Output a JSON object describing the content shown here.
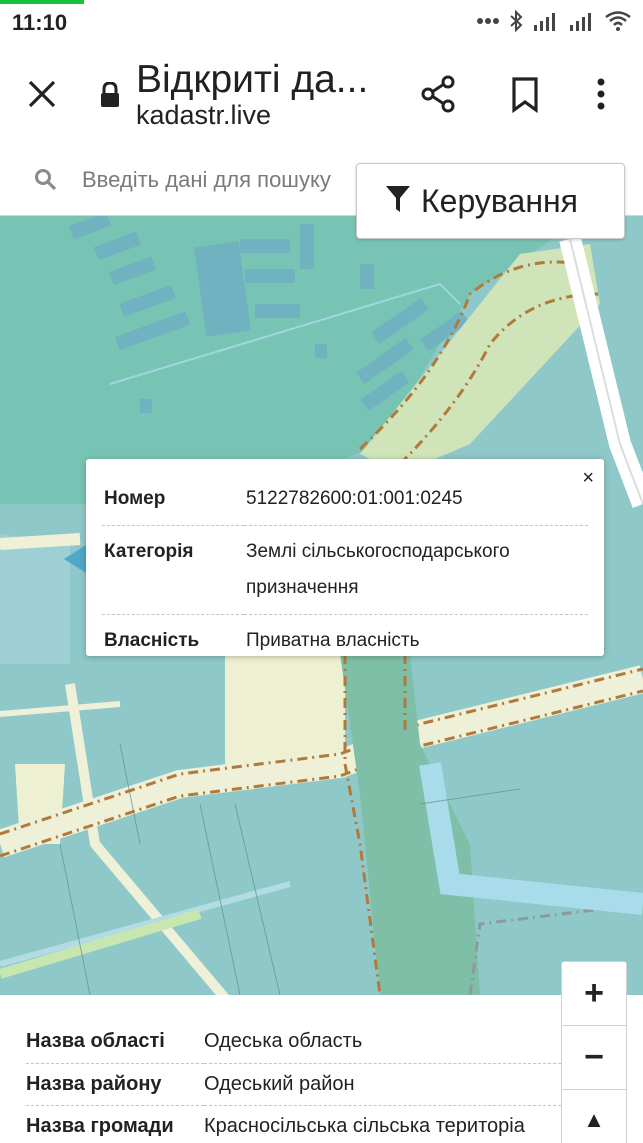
{
  "status_bar": {
    "time": "11:10",
    "icons": [
      "more-dots-icon",
      "bluetooth-icon",
      "signal-icon",
      "signal-icon",
      "wifi-icon"
    ]
  },
  "toolbar": {
    "title": "Відкриті да...",
    "url": "kadastr.live",
    "icons": [
      "close-icon",
      "lock-icon",
      "share-icon",
      "bookmark-icon",
      "more-vert-icon"
    ]
  },
  "search": {
    "placeholder": "Введіть дані для пошуку"
  },
  "controls": {
    "manage_label": "Керування",
    "zoom_in": "+",
    "zoom_out": "−",
    "compass": "▲"
  },
  "popup": {
    "close": "×",
    "rows": [
      {
        "key": "Номер",
        "value": "5122782600:01:001:0245"
      },
      {
        "key": "Категорія",
        "value": "Землі сільськогосподарського призначення"
      },
      {
        "key": "Власність",
        "value": "Приватна власність"
      }
    ]
  },
  "info": {
    "rows": [
      {
        "key": "Назва області",
        "value": "Одеська область"
      },
      {
        "key": "Назва району",
        "value": "Одеський район"
      },
      {
        "key": "Назва громади",
        "value": "Красносільська сільська територіа"
      }
    ]
  },
  "colors": {
    "map_water": "#8fc8c8",
    "map_parcel": "#a8d4c4",
    "road": "#eef0d8",
    "path": "#b07a3a",
    "accent_green": "#19c23a"
  }
}
